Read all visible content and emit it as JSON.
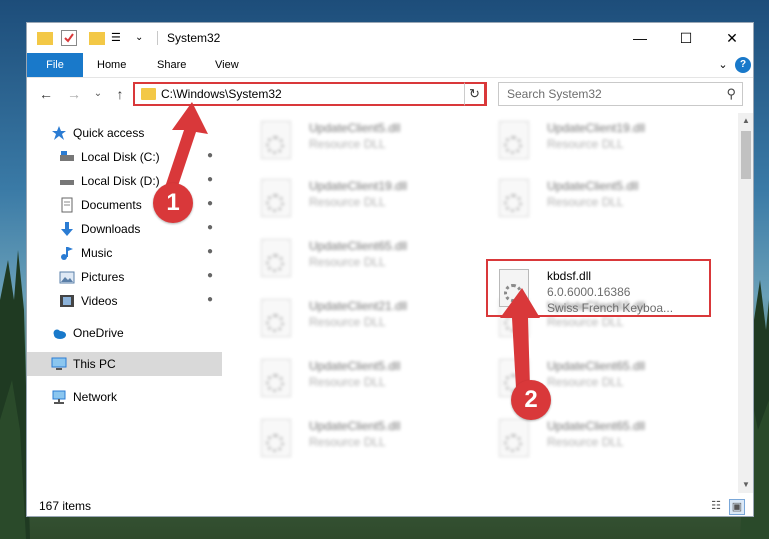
{
  "window": {
    "title": "System32",
    "controls": {
      "minimize": "—",
      "maximize": "☐",
      "close": "✕"
    }
  },
  "ribbon": {
    "tabs": [
      {
        "label": "File"
      },
      {
        "label": "Home"
      },
      {
        "label": "Share"
      },
      {
        "label": "View"
      }
    ],
    "expand_icon": "⌄",
    "help_icon": "?"
  },
  "nav": {
    "back": "←",
    "forward": "→",
    "recent": "⌄",
    "up": "↑",
    "address": "C:\\Windows\\System32",
    "address_dropdown": "⌄",
    "refresh": "↻",
    "search_placeholder": "Search System32",
    "search_icon": "⚲"
  },
  "sidebar": {
    "items": [
      {
        "label": "Quick access",
        "icon": "star-icon",
        "pinned": false
      },
      {
        "label": "Local Disk (C:)",
        "icon": "drive-icon",
        "pinned": true
      },
      {
        "label": "Local Disk (D:)",
        "icon": "drive-icon",
        "pinned": true
      },
      {
        "label": "Documents",
        "icon": "documents-icon",
        "pinned": true
      },
      {
        "label": "Downloads",
        "icon": "download-icon",
        "pinned": true
      },
      {
        "label": "Music",
        "icon": "music-icon",
        "pinned": true
      },
      {
        "label": "Pictures",
        "icon": "pictures-icon",
        "pinned": true
      },
      {
        "label": "Videos",
        "icon": "videos-icon",
        "pinned": true
      },
      {
        "label": "OneDrive",
        "icon": "cloud-icon",
        "pinned": false
      },
      {
        "label": "This PC",
        "icon": "computer-icon",
        "pinned": false,
        "selected": true
      },
      {
        "label": "Network",
        "icon": "network-icon",
        "pinned": false
      }
    ],
    "pin_glyph": "📌"
  },
  "files": {
    "left_column": [
      {
        "name": "UpdateClient5.dll",
        "desc": "Resource DLL"
      },
      {
        "name": "UpdateClient19.dll",
        "desc": "Resource DLL"
      },
      {
        "name": "UpdateClient65.dll",
        "desc": "Resource DLL"
      },
      {
        "name": "UpdateClient21.dll",
        "desc": "Resource DLL"
      },
      {
        "name": "UpdateClient5.dll",
        "desc": "Resource DLL"
      },
      {
        "name": "UpdateClient5.dll",
        "desc": "Resource DLL"
      }
    ],
    "right_column": [
      {
        "name": "UpdateClient19.dll",
        "desc": "Resource DLL"
      },
      {
        "name": "UpdateClient5.dll",
        "desc": "Resource DLL"
      },
      {
        "name": "UpdateClient63.dll",
        "desc": "Resource DLL"
      },
      {
        "name": "UpdateClient65.dll",
        "desc": "Resource DLL"
      },
      {
        "name": "UpdateClient65.dll",
        "desc": "Resource DLL"
      }
    ],
    "highlighted": {
      "name": "kbdsf.dll",
      "version": "6.0.6000.16386",
      "description": "Swiss French Keyboa..."
    }
  },
  "status": {
    "item_count": "167 items"
  },
  "annotations": [
    {
      "label": "1",
      "color": "#d9383a"
    },
    {
      "label": "2",
      "color": "#d9383a"
    }
  ],
  "colors": {
    "accent": "#1979ca",
    "highlight": "#d9383a",
    "selected_bg": "#d9d9d9"
  }
}
